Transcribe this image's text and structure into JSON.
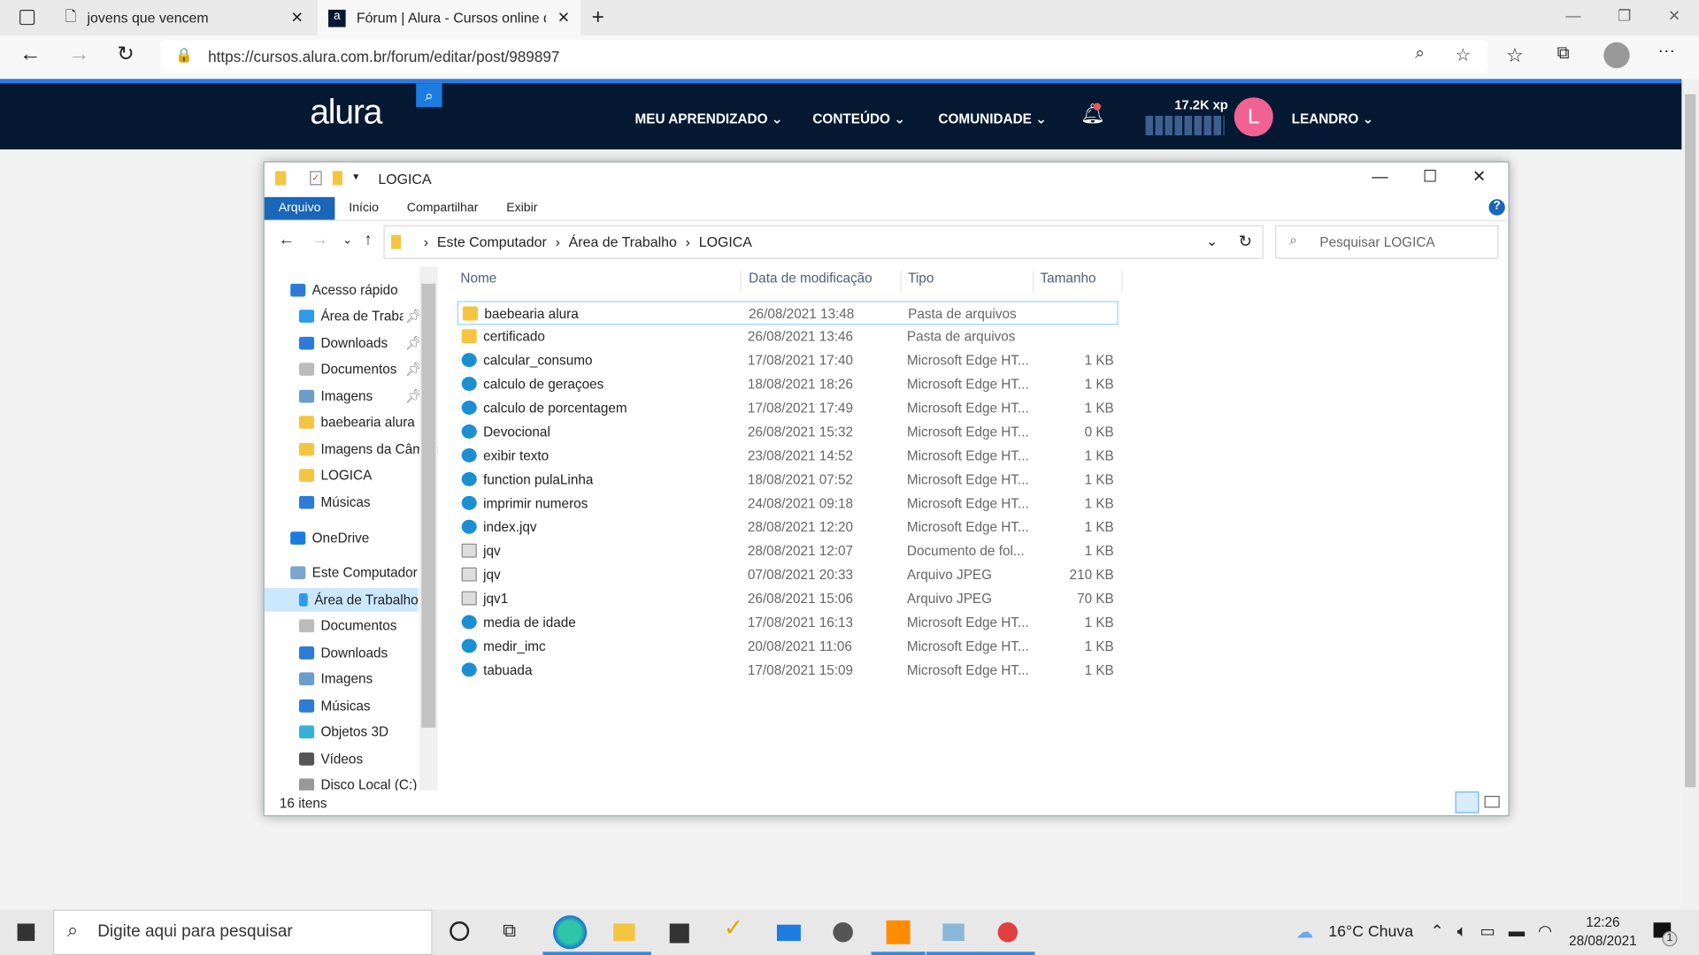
{
  "browser": {
    "tabs": [
      {
        "title": "jovens que vencem"
      },
      {
        "title": "Fórum | Alura - Cursos online de"
      }
    ],
    "url": "https://cursos.alura.com.br/forum/editar/post/989897"
  },
  "site": {
    "logo": "alura",
    "menu": [
      "MEU APRENDIZADO",
      "CONTEÚDO",
      "COMUNIDADE"
    ],
    "xp": "17.2K xp",
    "avatar_letter": "L",
    "user": "LEANDRO",
    "accent": "#2a7ae2",
    "avatar_color": "#f06292"
  },
  "explorer": {
    "title": "LOGICA",
    "ribbon": [
      "Arquivo",
      "Início",
      "Compartilhar",
      "Exibir"
    ],
    "path": [
      "Este Computador",
      "Área de Trabalho",
      "LOGICA"
    ],
    "search_placeholder": "Pesquisar LOGICA",
    "sidebar": [
      {
        "label": "Acesso rápido",
        "icon": "star-icon",
        "indent": 0
      },
      {
        "label": "Área de Trabalho",
        "icon": "desktop-icon",
        "indent": 1,
        "pin": true
      },
      {
        "label": "Downloads",
        "icon": "download-icon",
        "indent": 1,
        "pin": true
      },
      {
        "label": "Documentos",
        "icon": "document-icon",
        "indent": 1,
        "pin": true
      },
      {
        "label": "Imagens",
        "icon": "image-icon",
        "indent": 1,
        "pin": true
      },
      {
        "label": "baebearia alura",
        "icon": "folder-icon",
        "indent": 1
      },
      {
        "label": "Imagens da Câmera",
        "icon": "folder-icon",
        "indent": 1
      },
      {
        "label": "LOGICA",
        "icon": "folder-icon",
        "indent": 1
      },
      {
        "label": "Músicas",
        "icon": "music-icon",
        "indent": 1
      },
      {
        "label": "OneDrive",
        "icon": "cloud-icon",
        "indent": 0
      },
      {
        "label": "Este Computador",
        "icon": "computer-icon",
        "indent": 0
      },
      {
        "label": "Área de Trabalho",
        "icon": "desktop-icon",
        "indent": 1,
        "selected": true
      },
      {
        "label": "Documentos",
        "icon": "document-icon",
        "indent": 1
      },
      {
        "label": "Downloads",
        "icon": "download-icon",
        "indent": 1
      },
      {
        "label": "Imagens",
        "icon": "image-icon",
        "indent": 1
      },
      {
        "label": "Músicas",
        "icon": "music-icon",
        "indent": 1
      },
      {
        "label": "Objetos 3D",
        "icon": "cube-icon",
        "indent": 1
      },
      {
        "label": "Vídeos",
        "icon": "video-icon",
        "indent": 1
      },
      {
        "label": "Disco Local (C:)",
        "icon": "drive-icon",
        "indent": 1
      }
    ],
    "columns": [
      "Nome",
      "Data de modificação",
      "Tipo",
      "Tamanho"
    ],
    "files": [
      {
        "name": "baebearia alura",
        "date": "26/08/2021 13:48",
        "type": "Pasta de arquivos",
        "size": "",
        "icon": "folder-icon"
      },
      {
        "name": "certificado",
        "date": "26/08/2021 13:46",
        "type": "Pasta de arquivos",
        "size": "",
        "icon": "folder-icon"
      },
      {
        "name": "calcular_consumo",
        "date": "17/08/2021 17:40",
        "type": "Microsoft Edge HT...",
        "size": "1 KB",
        "icon": "edge-icon"
      },
      {
        "name": "calculo de geraçoes",
        "date": "18/08/2021 18:26",
        "type": "Microsoft Edge HT...",
        "size": "1 KB",
        "icon": "edge-icon"
      },
      {
        "name": "calculo de porcentagem",
        "date": "17/08/2021 17:49",
        "type": "Microsoft Edge HT...",
        "size": "1 KB",
        "icon": "edge-icon"
      },
      {
        "name": "Devocional",
        "date": "26/08/2021 15:32",
        "type": "Microsoft Edge HT...",
        "size": "0 KB",
        "icon": "edge-icon"
      },
      {
        "name": "exibir texto",
        "date": "23/08/2021 14:52",
        "type": "Microsoft Edge HT...",
        "size": "1 KB",
        "icon": "edge-icon"
      },
      {
        "name": "function pulaLinha",
        "date": "18/08/2021 07:52",
        "type": "Microsoft Edge HT...",
        "size": "1 KB",
        "icon": "edge-icon"
      },
      {
        "name": "imprimir numeros",
        "date": "24/08/2021 09:18",
        "type": "Microsoft Edge HT...",
        "size": "1 KB",
        "icon": "edge-icon"
      },
      {
        "name": "index.jqv",
        "date": "28/08/2021 12:20",
        "type": "Microsoft Edge HT...",
        "size": "1 KB",
        "icon": "edge-icon"
      },
      {
        "name": "jqv",
        "date": "28/08/2021 12:07",
        "type": "Documento de fol...",
        "size": "1 KB",
        "icon": "css-file-icon"
      },
      {
        "name": "jqv",
        "date": "07/08/2021 20:33",
        "type": "Arquivo JPEG",
        "size": "210 KB",
        "icon": "image-file-icon"
      },
      {
        "name": "jqv1",
        "date": "26/08/2021 15:06",
        "type": "Arquivo JPEG",
        "size": "70 KB",
        "icon": "image-file-icon"
      },
      {
        "name": "media de idade",
        "date": "17/08/2021 16:13",
        "type": "Microsoft Edge HT...",
        "size": "1 KB",
        "icon": "edge-icon"
      },
      {
        "name": "medir_imc",
        "date": "20/08/2021 11:06",
        "type": "Microsoft Edge HT...",
        "size": "1 KB",
        "icon": "edge-icon"
      },
      {
        "name": "tabuada",
        "date": "17/08/2021 15:09",
        "type": "Microsoft Edge HT...",
        "size": "1 KB",
        "icon": "edge-icon"
      }
    ],
    "status": "16 itens"
  },
  "taskbar": {
    "search_placeholder": "Digite aqui para pesquisar",
    "weather": "16°C  Chuva",
    "time": "12:26",
    "date": "28/08/2021",
    "notifications": "1"
  }
}
